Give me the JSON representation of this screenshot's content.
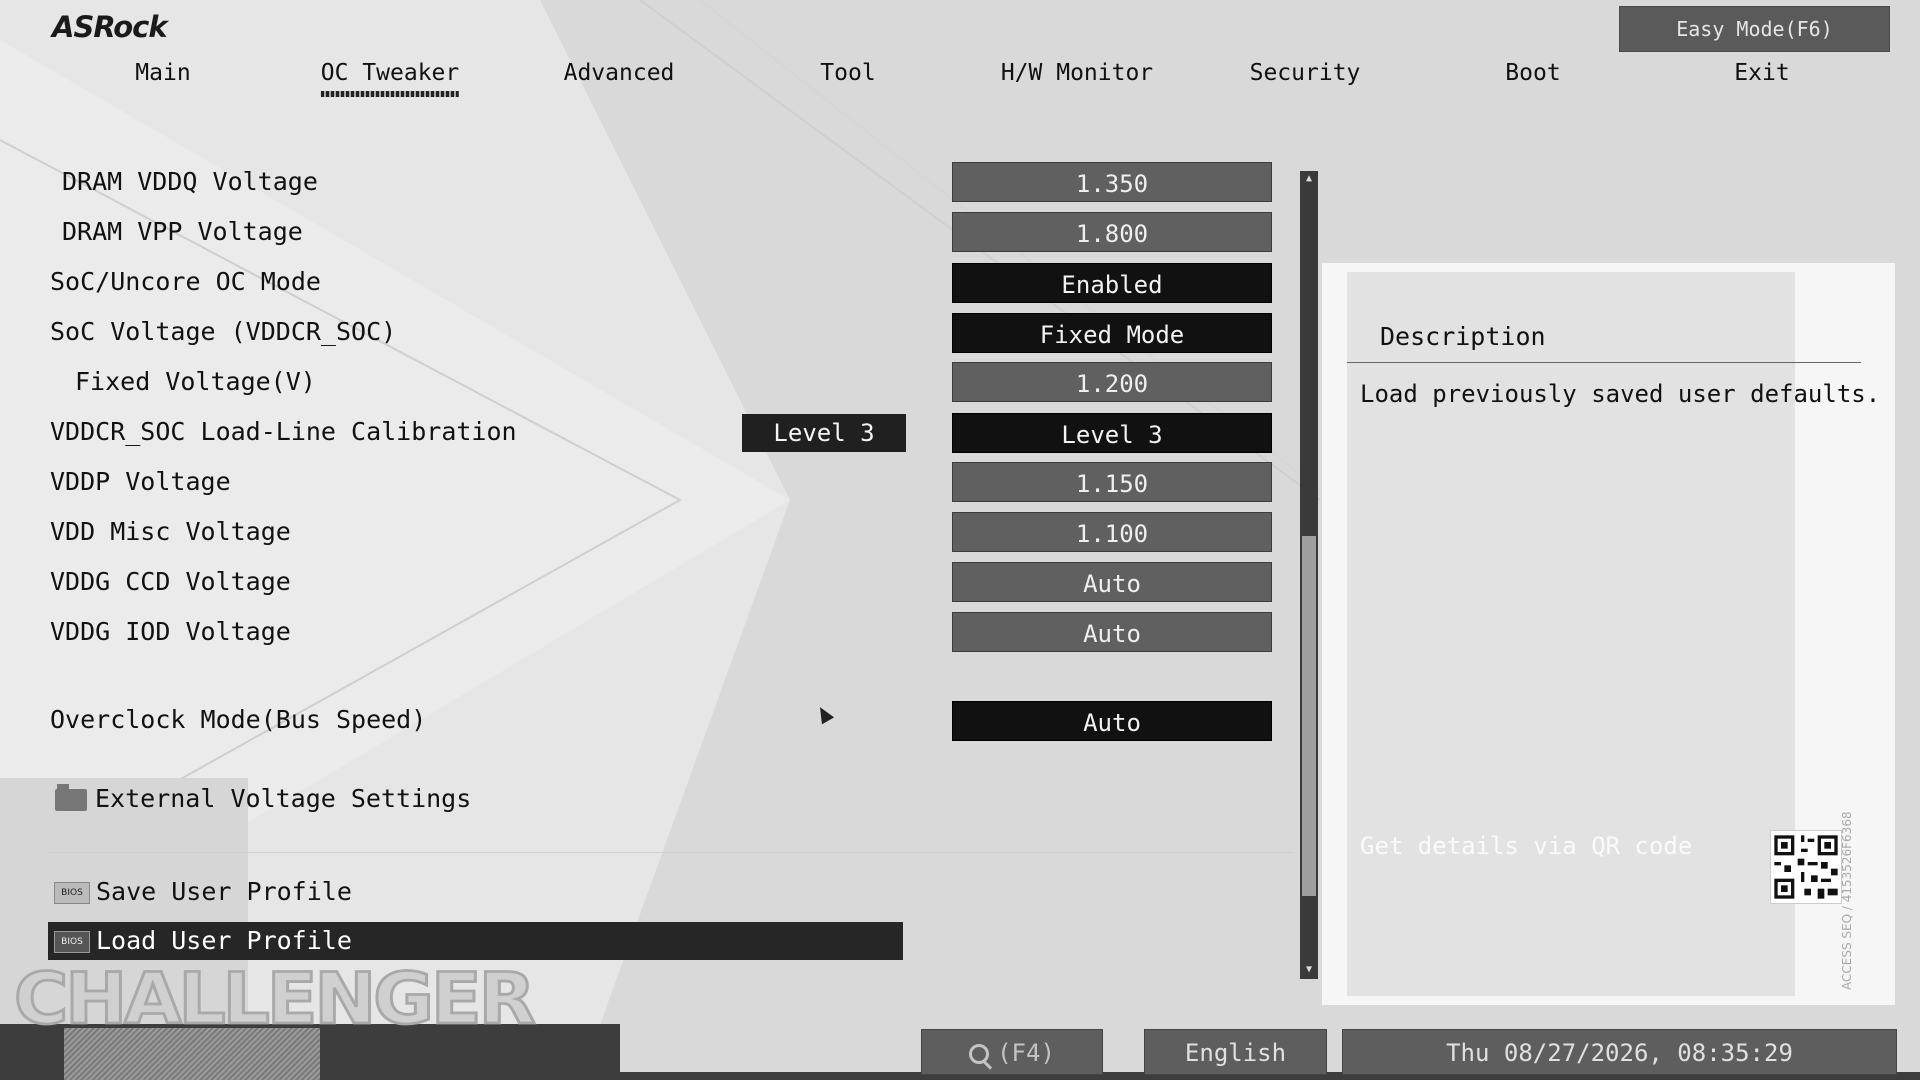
{
  "brand": "ASRock",
  "easy_mode_label": "Easy Mode(F6)",
  "nav": {
    "tabs": [
      "Main",
      "OC Tweaker",
      "Advanced",
      "Tool",
      "H/W Monitor",
      "Security",
      "Boot",
      "Exit"
    ],
    "active": "OC Tweaker"
  },
  "settings": [
    {
      "label": "DRAM VDDQ Voltage",
      "value": "1.350"
    },
    {
      "label": "DRAM VPP Voltage",
      "value": "1.800"
    },
    {
      "label": "SoC/Uncore OC Mode",
      "value": "Enabled"
    },
    {
      "label": "SoC Voltage (VDDCR_SOC)",
      "value": "Fixed Mode"
    },
    {
      "label": "Fixed Voltage(V)",
      "value": "1.200"
    },
    {
      "label": "VDDCR_SOC Load-Line Calibration",
      "value": "Level 3",
      "tag": "Level 3"
    },
    {
      "label": "VDDP Voltage",
      "value": "1.150"
    },
    {
      "label": "VDD Misc Voltage",
      "value": "1.100"
    },
    {
      "label": "VDDG CCD Voltage",
      "value": "Auto"
    },
    {
      "label": "VDDG IOD Voltage",
      "value": "Auto"
    },
    {
      "label": "Overclock Mode(Bus Speed)",
      "value": "Auto"
    }
  ],
  "folder": {
    "label": "External Voltage Settings",
    "icon": "folder-icon"
  },
  "profiles": {
    "save_label": "Save User Profile",
    "load_label": "Load User Profile",
    "icon_text": "BIOS"
  },
  "description": {
    "title": "Description",
    "text": "Load previously saved user defaults.",
    "qr_hint": "Get details via QR code",
    "side_code": "ACCESS SEQ / 4153526F6368"
  },
  "footer": {
    "watermark": "CHALLENGER",
    "search_label": "(F4)",
    "language": "English",
    "datetime": "Thu 08/27/2026, 08:35:29"
  },
  "colors": {
    "background": "#e4e4e4",
    "value_box": "#606060",
    "option_box": "#111111",
    "selected_row": "#262626"
  }
}
